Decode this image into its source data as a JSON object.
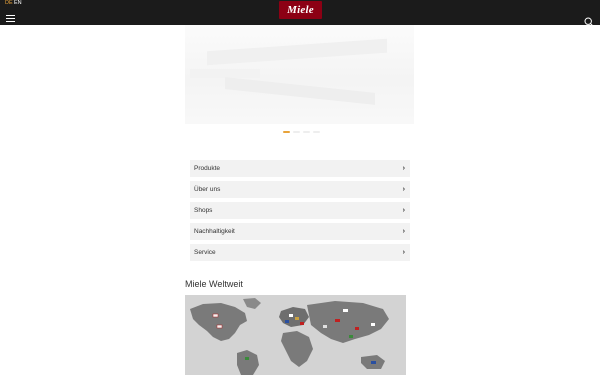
{
  "header": {
    "languages": [
      {
        "code": "DE",
        "active": true
      },
      {
        "code": "EN",
        "active": false
      }
    ],
    "logo_text": "Miele",
    "brand_color": "#8c0014",
    "active_lang_color": "#e8a33a",
    "menu_icon": "hamburger-icon",
    "search_icon": "search-icon"
  },
  "hero": {
    "carousel_pages": 4,
    "active_index": 0
  },
  "nav": {
    "items": [
      {
        "label": "Produkte"
      },
      {
        "label": "Über uns"
      },
      {
        "label": "Shops"
      },
      {
        "label": "Nachhaltigkeit"
      },
      {
        "label": "Service"
      }
    ],
    "chevron": "›"
  },
  "worldwide": {
    "title": "Miele Weltweit"
  }
}
